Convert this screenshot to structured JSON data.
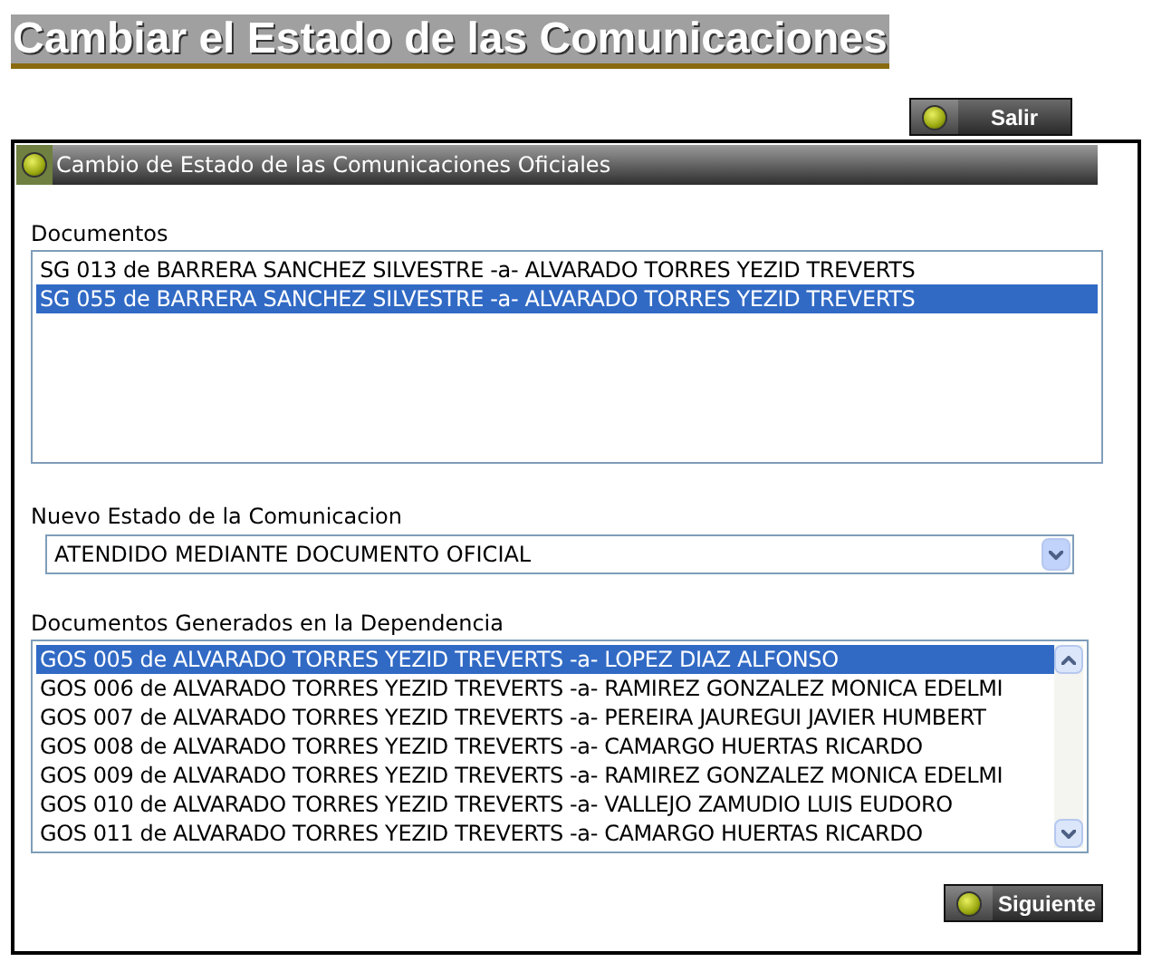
{
  "page_title": "Cambiar el Estado de las Comunicaciones",
  "exit_button": "Salir",
  "panel": {
    "title": "Cambio de Estado de las Comunicaciones Oficiales",
    "documents": {
      "label": "Documentos",
      "items": [
        {
          "text": "SG 013 de BARRERA SANCHEZ SILVESTRE -a- ALVARADO TORRES YEZID TREVERTS",
          "selected": false
        },
        {
          "text": "SG 055 de BARRERA SANCHEZ SILVESTRE -a- ALVARADO TORRES YEZID TREVERTS",
          "selected": true
        }
      ]
    },
    "new_state": {
      "label": "Nuevo Estado de la Comunicacion",
      "value": "ATENDIDO MEDIANTE DOCUMENTO OFICIAL"
    },
    "generated": {
      "label": "Documentos Generados en la Dependencia",
      "items": [
        {
          "text": "GOS 005 de ALVARADO TORRES YEZID TREVERTS -a- LOPEZ DIAZ ALFONSO",
          "selected": true
        },
        {
          "text": "GOS 006 de ALVARADO TORRES YEZID TREVERTS -a- RAMIREZ GONZALEZ MONICA EDELMI",
          "selected": false
        },
        {
          "text": "GOS 007 de ALVARADO TORRES YEZID TREVERTS -a- PEREIRA JAUREGUI JAVIER HUMBERT",
          "selected": false
        },
        {
          "text": "GOS 008 de ALVARADO TORRES YEZID TREVERTS -a- CAMARGO HUERTAS RICARDO",
          "selected": false
        },
        {
          "text": "GOS 009 de ALVARADO TORRES YEZID TREVERTS -a- RAMIREZ GONZALEZ MONICA EDELMI",
          "selected": false
        },
        {
          "text": "GOS 010 de ALVARADO TORRES YEZID TREVERTS -a- VALLEJO ZAMUDIO LUIS EUDORO",
          "selected": false
        },
        {
          "text": "GOS 011 de ALVARADO TORRES YEZID TREVERTS -a- CAMARGO HUERTAS RICARDO",
          "selected": false
        }
      ]
    },
    "next_button": "Siguiente"
  }
}
